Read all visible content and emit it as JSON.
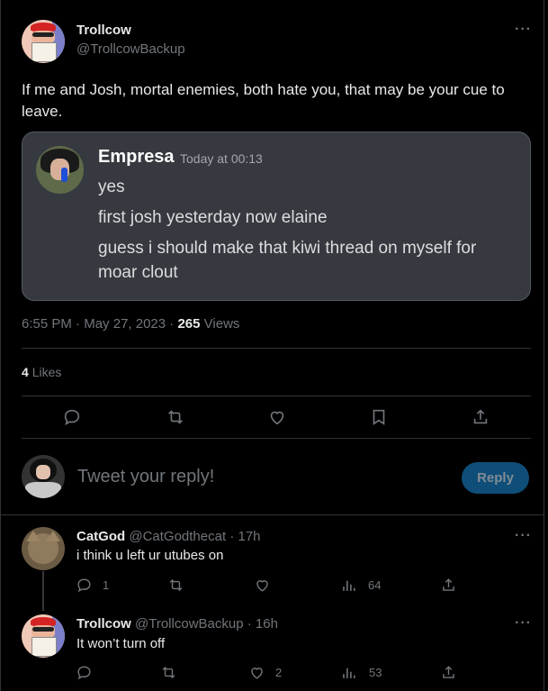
{
  "tweet": {
    "author_name": "Trollcow",
    "author_handle": "@TrollcowBackup",
    "text": "If me and Josh, mortal enemies, both hate you, that may be your cue to leave.",
    "embed": {
      "name": "Empresa",
      "time": "Today at 00:13",
      "messages": [
        "yes",
        "first josh yesterday now elaine",
        "guess i should make that kiwi thread on myself for moar clout"
      ]
    },
    "time": "6:55 PM",
    "date": "May 27, 2023",
    "views_count": "265",
    "views_label": "Views",
    "likes_count": "4",
    "likes_label": "Likes"
  },
  "composer": {
    "placeholder": "Tweet your reply!",
    "button_label": "Reply"
  },
  "replies": [
    {
      "name": "CatGod",
      "handle": "@CatGodthecat",
      "age": "17h",
      "text": "i think u left ur utubes on",
      "reply_count": "1",
      "retweet_count": "",
      "like_count": "",
      "view_count": "64"
    },
    {
      "name": "Trollcow",
      "handle": "@TrollcowBackup",
      "age": "16h",
      "text": "It won’t turn off",
      "reply_count": "",
      "retweet_count": "",
      "like_count": "2",
      "view_count": "53"
    }
  ],
  "icons": [
    "more-icon",
    "reply-icon",
    "retweet-icon",
    "like-icon",
    "bookmark-icon",
    "share-icon",
    "views-icon"
  ],
  "colors": {
    "background": "#000000",
    "text": "#e7e9ea",
    "muted": "#71767b",
    "accent": "#1d9bf0",
    "embed_bg": "#36393f"
  }
}
